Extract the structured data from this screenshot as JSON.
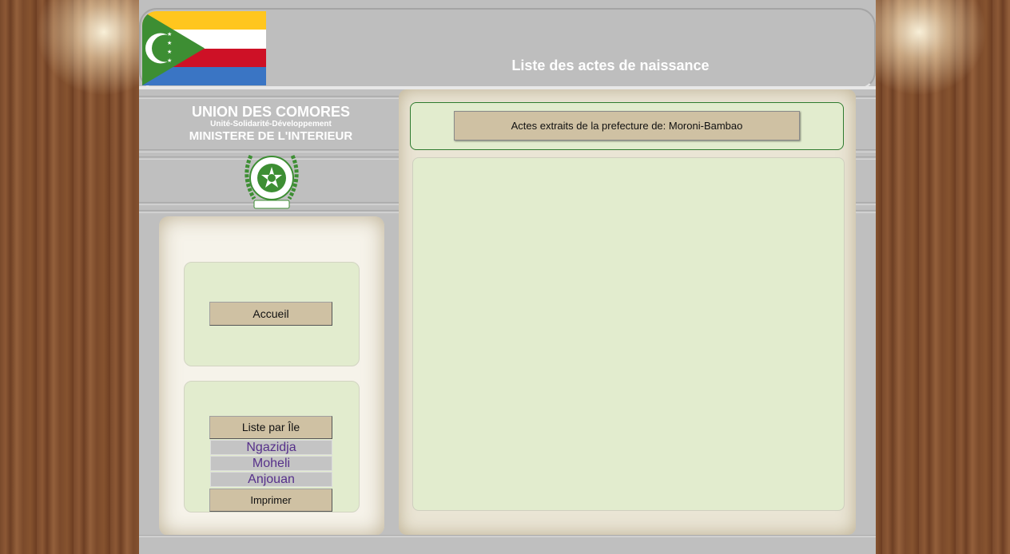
{
  "header": {
    "title": "Liste des actes de naissance",
    "flag_icon": "comoros-flag-icon",
    "flag_colors": [
      "#ffc61e",
      "#ffffff",
      "#ce1126",
      "#3a75c4",
      "#3d8e33"
    ]
  },
  "org": {
    "name": "UNION DES COMORES",
    "motto": "Unité-Solidarité-Développement",
    "ministry": "MINISTERE DE L'INTERIEUR",
    "emblem_icon": "comoros-emblem-icon"
  },
  "main": {
    "prefecture_label": "Actes extraits de la prefecture de: Moroni-Bambao"
  },
  "sidebar": {
    "home_label": "Accueil",
    "list_by_island_label": "Liste par Île",
    "islands": [
      {
        "label": "Ngazidja"
      },
      {
        "label": "Moheli"
      },
      {
        "label": "Anjouan"
      }
    ],
    "print_label": "Imprimer"
  },
  "colors": {
    "accent_green": "#2e7a2e",
    "panel_bg": "#e2ecce",
    "button_bg": "#cfc1a3",
    "link_color": "#56308a"
  }
}
